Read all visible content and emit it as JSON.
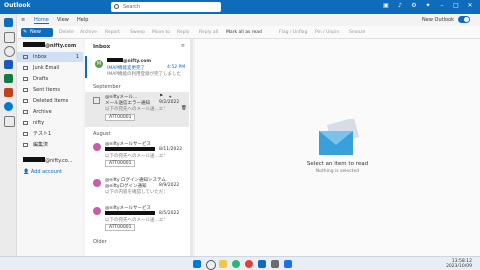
{
  "app": {
    "title": "Outlook"
  },
  "search": {
    "placeholder": "Search"
  },
  "tabs": {
    "home": "Home",
    "view": "View",
    "help": "Help",
    "new_outlook": "New Outlook"
  },
  "toolbar": {
    "new_mail": "New mail",
    "items": [
      "Delete",
      "Archive",
      "Report",
      "Sweep",
      "Move to",
      "Reply",
      "Reply all",
      "Forward",
      "Mark all as read",
      "Flag / Unflag",
      "Pin / Unpin",
      "Snooze"
    ]
  },
  "account": {
    "email": "@nifty.com",
    "email2": "@nifty.co...",
    "add_account": "Add account"
  },
  "folders": [
    {
      "label": "Inbox",
      "count": "1",
      "active": true
    },
    {
      "label": "Junk Email",
      "count": ""
    },
    {
      "label": "Drafts",
      "count": ""
    },
    {
      "label": "Sent Items",
      "count": ""
    },
    {
      "label": "Deleted Items",
      "count": ""
    },
    {
      "label": "Archive",
      "count": ""
    },
    {
      "label": "nifty",
      "count": ""
    },
    {
      "label": "テスト1",
      "count": ""
    },
    {
      "label": "編集済",
      "count": ""
    }
  ],
  "list": {
    "title": "Inbox",
    "sections": {
      "september": "September",
      "august": "August",
      "older": "Older"
    },
    "messages": [
      {
        "from": "@nifty.com",
        "subject": "IMAP機能変更完了",
        "preview": "IMAP機能の利用登録が完了しました",
        "time": "4:52 PM",
        "avatar": "M",
        "color": "#5b9b4d",
        "bold": true
      },
      {
        "from": "@niftyメール...",
        "subject": "メール送信エラー通知",
        "preview": "以下の宛先へのメール送...エラー...",
        "time": "9/2/2022",
        "attachment": "ATT00001",
        "color": "#a8a8a8"
      },
      {
        "from": "@niftyメールサービス",
        "subject": "",
        "preview": "以下の宛先へのメール送...エラー...",
        "time": "8/11/2022",
        "attachment": "ATT00001",
        "color": "#c45ea7"
      },
      {
        "from": "@nifty ログイン通知システム",
        "subject": "@niftyログイン通知",
        "preview": "以下の内容を確認していただき...",
        "time": "8/9/2022",
        "color": "#c45ea7"
      },
      {
        "from": "@niftyメールサービス",
        "subject": "",
        "preview": "以下の宛先へのメール送...エラー...",
        "time": "8/5/2022",
        "attachment": "ATT00001",
        "color": "#c45ea7"
      }
    ]
  },
  "reading": {
    "title": "Select an item to read",
    "subtitle": "Nothing is selected"
  },
  "taskbar": {
    "time": "13:58:12",
    "date": "2023/10/09"
  },
  "colors": {
    "accent": "#0f6cbd"
  }
}
